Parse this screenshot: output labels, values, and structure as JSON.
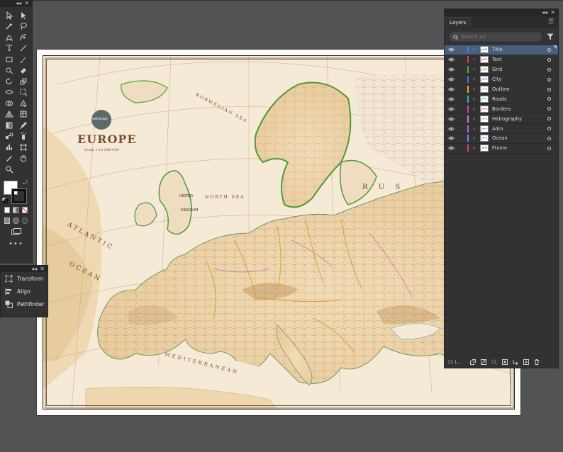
{
  "panels": {
    "collapse_glyph": "◂◂",
    "close_glyph": "✕"
  },
  "map": {
    "title": "EUROPE",
    "logo_text": "Ueffermly",
    "scale_text": "Scale 1:10 000 000",
    "labels": {
      "norwegian_sea": "NORWEGIAN SEA",
      "north_sea": "NORTH SEA",
      "atlantic": "ATLANTIC",
      "ocean": "OCEAN",
      "mediterranean": "MEDITERRANEAN",
      "kingdom": "KINGDOM",
      "united": "UNITED",
      "russia": "R U S"
    }
  },
  "tools_panel": {
    "more_label": "•••"
  },
  "props_panel": {
    "items": [
      {
        "label": "Transform",
        "icon": "transform-icon"
      },
      {
        "label": "Align",
        "icon": "align-icon"
      },
      {
        "label": "Pathfinder",
        "icon": "pathfinder-icon"
      }
    ]
  },
  "layers_panel": {
    "tab_label": "Layers",
    "menu_glyph": "☰",
    "search_placeholder": "Search All",
    "footer_count": "11 L...",
    "layers": [
      {
        "name": "Title",
        "color": "#4f7bd6",
        "selected": true
      },
      {
        "name": "Text",
        "color": "#d0453a",
        "selected": false
      },
      {
        "name": "Grid",
        "color": "#3fae46",
        "selected": false
      },
      {
        "name": "City",
        "color": "#4d6ad8",
        "selected": false
      },
      {
        "name": "Outline",
        "color": "#e8a23a",
        "selected": false
      },
      {
        "name": "Roads",
        "color": "#2cb6c3",
        "selected": false
      },
      {
        "name": "Borders",
        "color": "#d63f98",
        "selected": false
      },
      {
        "name": "Hidrography",
        "color": "#b08ad8",
        "selected": false
      },
      {
        "name": "Adm",
        "color": "#c45ad8",
        "selected": false
      },
      {
        "name": "Ocean",
        "color": "#7a7af0",
        "selected": false
      },
      {
        "name": "Frame",
        "color": "#d84a4a",
        "selected": false
      }
    ]
  }
}
